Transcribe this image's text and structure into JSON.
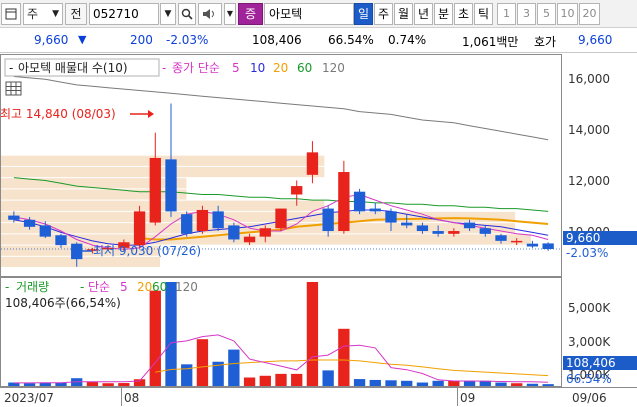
{
  "toolbar": {
    "market_label": "주",
    "prev_label": "전",
    "stock_code": "052710",
    "stock_badge": "증",
    "stock_name": "아모텍",
    "periods": [
      "일",
      "주",
      "월",
      "년",
      "분",
      "초",
      "틱"
    ],
    "active_period": "일",
    "intervals": [
      "1",
      "3",
      "5",
      "10",
      "20"
    ]
  },
  "quote": {
    "price": "9,660",
    "change": "200",
    "change_pct": "-2.03%",
    "volume": "108,406",
    "volume_ratio": "66.54%",
    "turnover_pct": "0.74%",
    "amount": "1,061백만",
    "ask_label": "호가",
    "ask_price": "9,660"
  },
  "colors": {
    "up": "#e8231c",
    "down": "#1f5fd6",
    "ma5": "#d636c8",
    "ma10": "#2a2ae0",
    "ma20": "#f0a000",
    "ma60": "#1a9a2a",
    "ma120": "#7a7a7a",
    "axis_tag": "#1c5cc8",
    "volume_profile": "#f7e3cc"
  },
  "chart_data": {
    "type": "candlestick",
    "legend": {
      "profile_label": "아모텍 매물대 수(10)",
      "ma_prefix": "종가 단순",
      "ma_periods": [
        "5",
        "10",
        "20",
        "60",
        "120"
      ]
    },
    "annotations": {
      "high": "최고 14,840 (08/03)",
      "low": "최저 9,030 (07/26)"
    },
    "price_axis": {
      "ticks": [
        "16,000",
        "14,000",
        "12,000",
        "10,000"
      ],
      "ylim": [
        8700,
        16600
      ],
      "current": "9,660",
      "current_value": 9660,
      "current_change": "-2.03%"
    },
    "x_ticks": [
      "2023/07",
      "08",
      "09",
      "09/06"
    ],
    "candles": [
      {
        "o": 10850,
        "h": 11000,
        "l": 10600,
        "c": 10700
      },
      {
        "o": 10700,
        "h": 10800,
        "l": 10350,
        "c": 10450
      },
      {
        "o": 10500,
        "h": 10650,
        "l": 10050,
        "c": 10100
      },
      {
        "o": 10150,
        "h": 10200,
        "l": 9700,
        "c": 9800
      },
      {
        "o": 9850,
        "h": 9900,
        "l": 9030,
        "c": 9300
      },
      {
        "o": 9600,
        "h": 9700,
        "l": 9500,
        "c": 9650
      },
      {
        "o": 9650,
        "h": 9800,
        "l": 9600,
        "c": 9700
      },
      {
        "o": 9700,
        "h": 10000,
        "l": 9600,
        "c": 9900
      },
      {
        "o": 9800,
        "h": 11200,
        "l": 9700,
        "c": 11000
      },
      {
        "o": 10600,
        "h": 13800,
        "l": 10500,
        "c": 12900
      },
      {
        "o": 12850,
        "h": 14840,
        "l": 10800,
        "c": 11000
      },
      {
        "o": 10900,
        "h": 11000,
        "l": 10100,
        "c": 10200
      },
      {
        "o": 10300,
        "h": 11200,
        "l": 10200,
        "c": 11050
      },
      {
        "o": 11000,
        "h": 11200,
        "l": 10300,
        "c": 10400
      },
      {
        "o": 10500,
        "h": 10600,
        "l": 9900,
        "c": 10000
      },
      {
        "o": 9900,
        "h": 10200,
        "l": 9800,
        "c": 10100
      },
      {
        "o": 10100,
        "h": 10500,
        "l": 9900,
        "c": 10400
      },
      {
        "o": 10400,
        "h": 11000,
        "l": 10300,
        "c": 11100
      },
      {
        "o": 11600,
        "h": 12100,
        "l": 11200,
        "c": 11900
      },
      {
        "o": 12300,
        "h": 13500,
        "l": 12000,
        "c": 13100
      },
      {
        "o": 11100,
        "h": 11200,
        "l": 10100,
        "c": 10300
      },
      {
        "o": 10300,
        "h": 12800,
        "l": 10200,
        "c": 12400
      },
      {
        "o": 11700,
        "h": 11800,
        "l": 10900,
        "c": 11000
      },
      {
        "o": 11100,
        "h": 11300,
        "l": 10900,
        "c": 11000
      },
      {
        "o": 11000,
        "h": 11100,
        "l": 10300,
        "c": 10600
      },
      {
        "o": 10600,
        "h": 10900,
        "l": 10400,
        "c": 10500
      },
      {
        "o": 10500,
        "h": 10600,
        "l": 10200,
        "c": 10300
      },
      {
        "o": 10300,
        "h": 10500,
        "l": 10100,
        "c": 10200
      },
      {
        "o": 10200,
        "h": 10400,
        "l": 10100,
        "c": 10300
      },
      {
        "o": 10600,
        "h": 10700,
        "l": 10300,
        "c": 10400
      },
      {
        "o": 10400,
        "h": 10500,
        "l": 10100,
        "c": 10200
      },
      {
        "o": 10150,
        "h": 10200,
        "l": 9850,
        "c": 9950
      },
      {
        "o": 9950,
        "h": 10050,
        "l": 9800,
        "c": 9950
      },
      {
        "o": 9850,
        "h": 9950,
        "l": 9700,
        "c": 9750
      },
      {
        "o": 9860,
        "h": 9900,
        "l": 9600,
        "c": 9660
      }
    ],
    "ma": {
      "ma5": [
        10800,
        10700,
        10550,
        10300,
        10000,
        9800,
        9700,
        9650,
        9700,
        10100,
        10550,
        10900,
        11000,
        10900,
        10700,
        10400,
        10300,
        10300,
        10550,
        11000,
        11200,
        11500,
        11600,
        11400,
        11200,
        11050,
        10900,
        10700,
        10600,
        10500,
        10400,
        10300,
        10200,
        10150,
        10000
      ],
      "ma10": [
        10700,
        10600,
        10450,
        10250,
        10100,
        9950,
        9850,
        9800,
        9800,
        9900,
        10050,
        10200,
        10300,
        10350,
        10400,
        10450,
        10550,
        10650,
        10750,
        10850,
        10950,
        11000,
        11050,
        11050,
        11000,
        10900,
        10800,
        10700,
        10600,
        10550,
        10500,
        10450,
        10350,
        10250,
        10150
      ],
      "ma20": [
        null,
        null,
        null,
        null,
        null,
        null,
        null,
        null,
        10050,
        10000,
        10000,
        10050,
        10100,
        10150,
        10200,
        10250,
        10300,
        10350,
        10450,
        10500,
        10550,
        10600,
        10650,
        10700,
        10720,
        10730,
        10740,
        10750,
        10760,
        10750,
        10730,
        10700,
        10650,
        10600,
        10550
      ],
      "ma60": [
        12200,
        12150,
        12100,
        12000,
        11900,
        11850,
        11800,
        11750,
        11700,
        11700,
        11700,
        11650,
        11600,
        11600,
        11550,
        11500,
        11500,
        11450,
        11450,
        11400,
        11400,
        11350,
        11350,
        11300,
        11300,
        11250,
        11250,
        11200,
        11200,
        11150,
        11150,
        11100,
        11100,
        11050,
        11000
      ],
      "ma120": [
        15800,
        15750,
        15700,
        15600,
        15500,
        15450,
        15400,
        15350,
        15300,
        15250,
        15200,
        15150,
        15100,
        15050,
        15000,
        14950,
        14900,
        14850,
        14800,
        14750,
        14700,
        14650,
        14550,
        14500,
        14450,
        14350,
        14250,
        14200,
        14150,
        14050,
        13950,
        13850,
        13750,
        13650,
        13550
      ]
    },
    "volume_profile": [
      {
        "low": 9000,
        "high": 9400,
        "size": 0.3
      },
      {
        "low": 9400,
        "high": 9800,
        "size": 0.3
      },
      {
        "low": 9800,
        "high": 10200,
        "size": 1.0
      },
      {
        "low": 10200,
        "high": 10600,
        "size": 0.97
      },
      {
        "low": 10600,
        "high": 11000,
        "size": 0.97
      },
      {
        "low": 11000,
        "high": 11400,
        "size": 0.61
      },
      {
        "low": 11400,
        "high": 11800,
        "size": 0.35
      },
      {
        "low": 11800,
        "high": 12200,
        "size": 0.35
      },
      {
        "low": 12200,
        "high": 12600,
        "size": 0.61
      },
      {
        "low": 12600,
        "high": 13000,
        "size": 0.61
      }
    ],
    "volume": {
      "label": "거래량",
      "ma_prefix": "단순",
      "ma_periods": [
        "5",
        "20",
        "60",
        "120"
      ],
      "current_text": "108,406주(66,54%)",
      "axis_ticks": [
        "5,000K",
        "3,000K",
        "1,000K"
      ],
      "ylim": [
        0,
        6000
      ],
      "tag": "108,406",
      "tag_pct": "66.54%",
      "values": [
        200,
        160,
        190,
        180,
        450,
        250,
        160,
        170,
        390,
        5500,
        6000,
        1250,
        2700,
        1400,
        2100,
        490,
        590,
        700,
        700,
        6000,
        900,
        3300,
        400,
        350,
        330,
        300,
        200,
        300,
        300,
        300,
        300,
        200,
        160,
        130,
        108
      ],
      "ma5": [
        180,
        180,
        185,
        190,
        240,
        250,
        250,
        240,
        290,
        1350,
        2500,
        2600,
        2850,
        2950,
        2600,
        1550,
        1350,
        1150,
        930,
        1680,
        1780,
        2300,
        2350,
        2200,
        1060,
        940,
        720,
        360,
        290,
        290,
        280,
        260,
        250,
        240,
        220
      ],
      "ma20": [
        null,
        null,
        null,
        null,
        null,
        null,
        null,
        null,
        null,
        800,
        950,
        1000,
        1100,
        1200,
        1300,
        1350,
        1400,
        1450,
        1450,
        1500,
        1500,
        1500,
        1450,
        1350,
        1250,
        1200,
        1100,
        1000,
        900,
        850,
        800,
        750,
        700,
        650,
        600
      ]
    }
  }
}
